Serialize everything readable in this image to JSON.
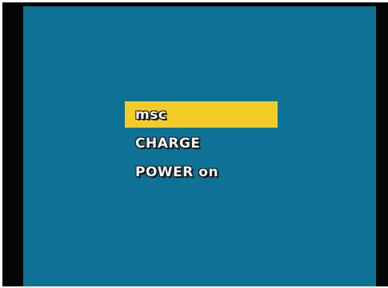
{
  "menu": {
    "items": [
      {
        "label": "msc",
        "selected": true
      },
      {
        "label": "CHARGE",
        "selected": false
      },
      {
        "label": "POWER on",
        "selected": false
      }
    ]
  },
  "colors": {
    "screen_background": "#0e7297",
    "bezel": "#050505",
    "highlight": "#f5cc26",
    "text": "#f4f4f4"
  }
}
